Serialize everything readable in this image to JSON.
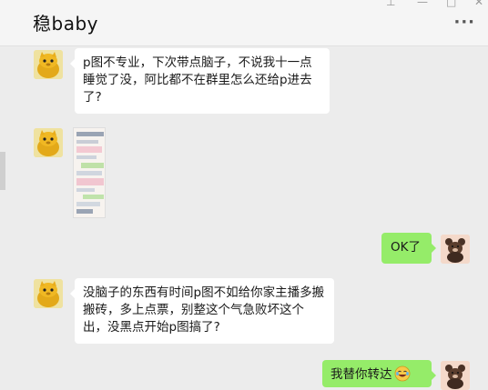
{
  "window": {
    "title": "稳baby",
    "controls": [
      "⊥",
      "—",
      "□",
      "✕"
    ],
    "more_label": "···"
  },
  "messages": [
    {
      "side": "left",
      "type": "text",
      "text": "p图不专业，下次带点脑子，不说我十一点睡觉了没，阿比都不在群里怎么还给p进去了?"
    },
    {
      "side": "left",
      "type": "image"
    },
    {
      "side": "right",
      "type": "text",
      "text": "OK了"
    },
    {
      "side": "left",
      "type": "text",
      "text": "没脑子的东西有时间p图不如给你家主播多搬搬砖，多上点票，别整这个气急败坏这个出，没黑点开始p图搞了?"
    },
    {
      "side": "right",
      "type": "text",
      "text": "我替你转达",
      "emoji": "laugh-cry-emoji"
    }
  ],
  "colors": {
    "outgoing_bubble": "#95ec69",
    "incoming_bubble": "#ffffff",
    "background": "#ececec"
  }
}
